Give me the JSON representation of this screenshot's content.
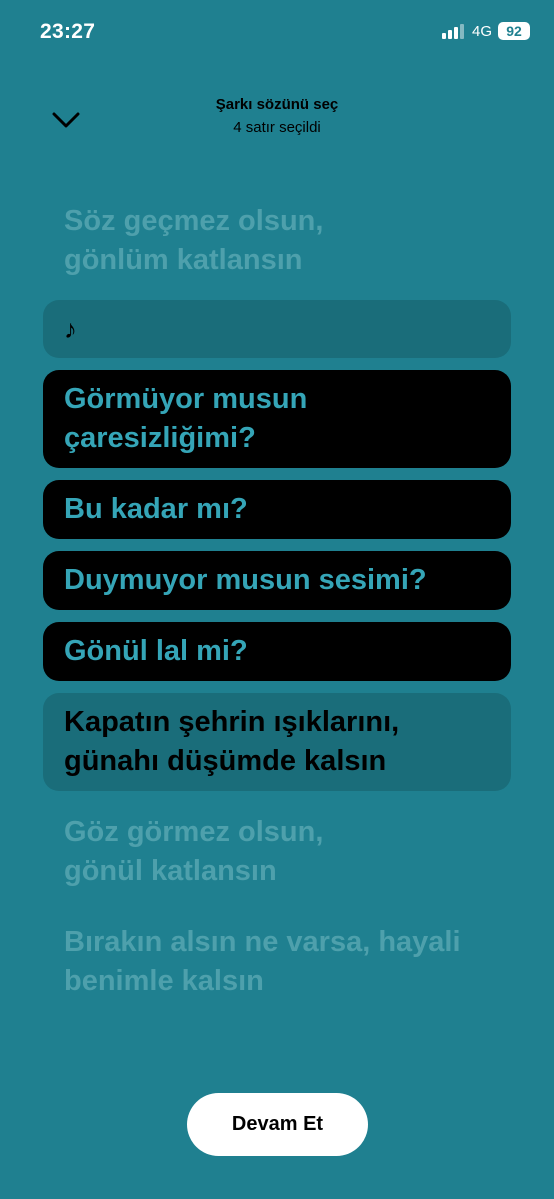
{
  "status_bar": {
    "time": "23:27",
    "network": "4G",
    "battery": "92"
  },
  "header": {
    "title": "Şarkı sözünü seç",
    "subtitle": "4 satır seçildi",
    "back_icon": "chevron-down-icon"
  },
  "lyrics": [
    {
      "lines": [
        "Söz geçmez olsun,",
        "gönlüm katlansın"
      ],
      "state": "unselected"
    },
    {
      "lines": [
        "♪"
      ],
      "state": "instrumental"
    },
    {
      "lines": [
        "Görmüyor musun",
        "çaresizliğimi?"
      ],
      "state": "selected"
    },
    {
      "lines": [
        "Bu kadar mı?"
      ],
      "state": "selected"
    },
    {
      "lines": [
        "Duymuyor musun sesimi?"
      ],
      "state": "selected"
    },
    {
      "lines": [
        "Gönül lal mi?"
      ],
      "state": "selected"
    },
    {
      "lines": [
        "Kapatın şehrin ışıklarını,",
        "günahı düşümde kalsın"
      ],
      "state": "available"
    },
    {
      "lines": [
        "Göz görmez olsun,",
        "gönül katlansın"
      ],
      "state": "unselected"
    },
    {
      "lines": [
        "Bırakın alsın ne varsa, hayali",
        "benimle kalsın"
      ],
      "state": "unselected"
    }
  ],
  "continue_button": {
    "label": "Devam Et"
  },
  "colors": {
    "background": "#1f8090",
    "selected_card": "#000000",
    "selected_text": "#35a5b7",
    "available_card": "#1a6d7a",
    "unselected_text": "#4ea0ac"
  }
}
